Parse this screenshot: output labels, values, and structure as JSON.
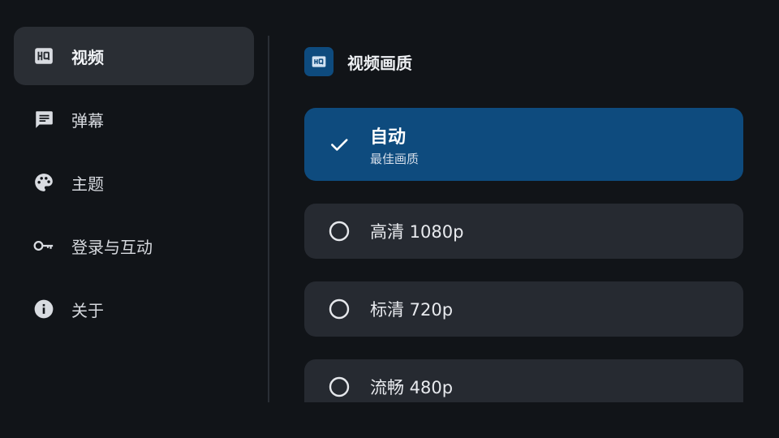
{
  "sidebar": {
    "items": [
      {
        "label": "视频",
        "icon": "hq-icon",
        "active": true
      },
      {
        "label": "弹幕",
        "icon": "comment-icon",
        "active": false
      },
      {
        "label": "主题",
        "icon": "palette-icon",
        "active": false
      },
      {
        "label": "登录与互动",
        "icon": "key-icon",
        "active": false
      },
      {
        "label": "关于",
        "icon": "info-icon",
        "active": false
      }
    ]
  },
  "section": {
    "title": "视频画质",
    "icon": "hq-icon"
  },
  "options": [
    {
      "label": "自动",
      "sub": "最佳画质",
      "selected": true
    },
    {
      "label": "高清 1080p",
      "selected": false
    },
    {
      "label": "标清 720p",
      "selected": false
    },
    {
      "label": "流畅 480p",
      "selected": false
    }
  ],
  "colors": {
    "background": "#111418",
    "sidebar_active": "#2a2e34",
    "accent": "#0e4b7e",
    "option_bg": "#262a31",
    "icon": "#d9dce1"
  }
}
